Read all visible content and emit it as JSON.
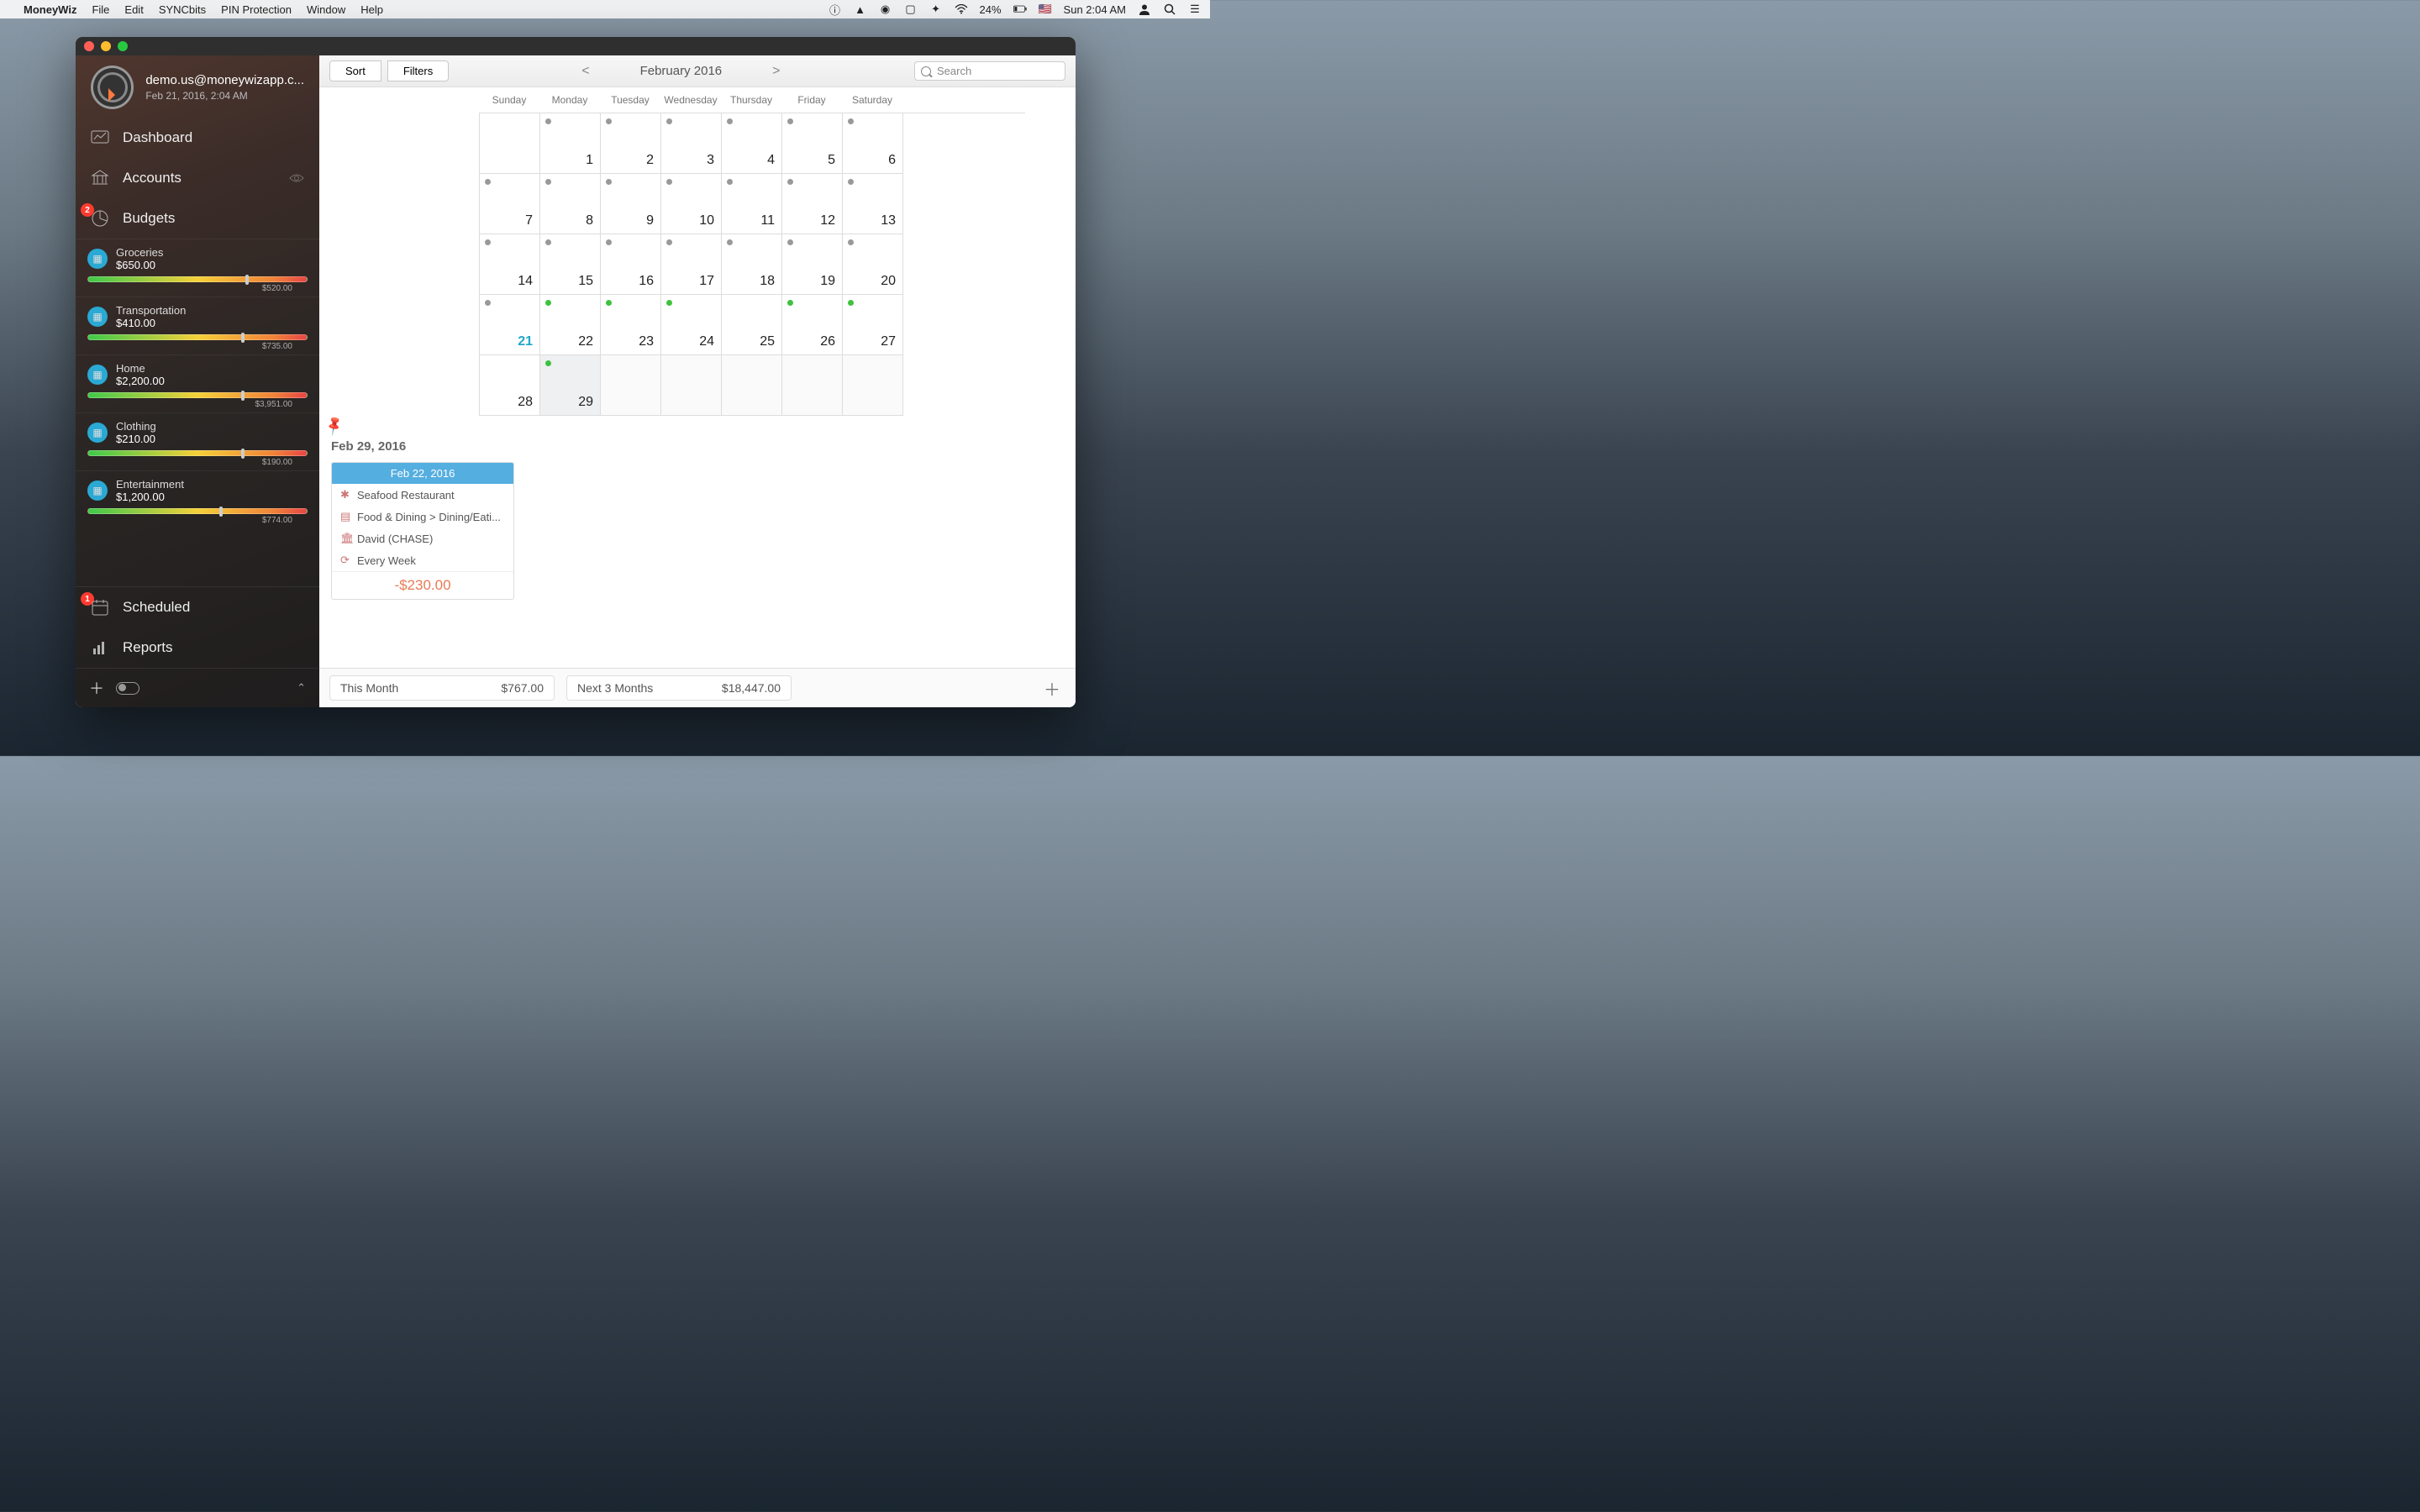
{
  "menubar": {
    "app": "MoneyWiz",
    "items": [
      "File",
      "Edit",
      "SYNCbits",
      "PIN Protection",
      "Window",
      "Help"
    ],
    "battery": "24%",
    "clock": "Sun 2:04 AM"
  },
  "profile": {
    "email": "demo.us@moneywizapp.c...",
    "datetime": "Feb 21, 2016, 2:04 AM"
  },
  "nav": {
    "dashboard": "Dashboard",
    "accounts": "Accounts",
    "budgets": "Budgets",
    "budgets_badge": "2",
    "scheduled": "Scheduled",
    "scheduled_badge": "1",
    "reports": "Reports"
  },
  "budgets": [
    {
      "name": "Groceries",
      "amount": "$650.00",
      "sub": "$520.00",
      "knob": 72
    },
    {
      "name": "Transportation",
      "amount": "$410.00",
      "sub": "$735.00",
      "knob": 70
    },
    {
      "name": "Home",
      "amount": "$2,200.00",
      "sub": "$3,951.00",
      "knob": 70
    },
    {
      "name": "Clothing",
      "amount": "$210.00",
      "sub": "$190.00",
      "knob": 70
    },
    {
      "name": "Entertainment",
      "amount": "$1,200.00",
      "sub": "$774.00",
      "knob": 60
    }
  ],
  "toolbar": {
    "sort": "Sort",
    "filters": "Filters",
    "prev": "<",
    "month": "February 2016",
    "next": ">",
    "search_placeholder": "Search"
  },
  "calendar": {
    "days": [
      "Sunday",
      "Monday",
      "Tuesday",
      "Wednesday",
      "Thursday",
      "Friday",
      "Saturday"
    ],
    "weeks": [
      [
        {
          "n": "",
          "dot": ""
        },
        {
          "n": "1",
          "dot": "g"
        },
        {
          "n": "2",
          "dot": "g"
        },
        {
          "n": "3",
          "dot": "g"
        },
        {
          "n": "4",
          "dot": "g"
        },
        {
          "n": "5",
          "dot": "g"
        },
        {
          "n": "6",
          "dot": "g"
        }
      ],
      [
        {
          "n": "7",
          "dot": "g"
        },
        {
          "n": "8",
          "dot": "g"
        },
        {
          "n": "9",
          "dot": "g"
        },
        {
          "n": "10",
          "dot": "g"
        },
        {
          "n": "11",
          "dot": "g"
        },
        {
          "n": "12",
          "dot": "g"
        },
        {
          "n": "13",
          "dot": "g"
        }
      ],
      [
        {
          "n": "14",
          "dot": "g"
        },
        {
          "n": "15",
          "dot": "g"
        },
        {
          "n": "16",
          "dot": "g"
        },
        {
          "n": "17",
          "dot": "g"
        },
        {
          "n": "18",
          "dot": "g"
        },
        {
          "n": "19",
          "dot": "g"
        },
        {
          "n": "20",
          "dot": "g"
        }
      ],
      [
        {
          "n": "21",
          "dot": "g",
          "today": true
        },
        {
          "n": "22",
          "dot": "gr"
        },
        {
          "n": "23",
          "dot": "gr"
        },
        {
          "n": "24",
          "dot": "gr"
        },
        {
          "n": "25",
          "dot": ""
        },
        {
          "n": "26",
          "dot": "gr"
        },
        {
          "n": "27",
          "dot": "gr"
        }
      ],
      [
        {
          "n": "28",
          "dot": ""
        },
        {
          "n": "29",
          "dot": "gr",
          "sel": true
        },
        {
          "n": "",
          "dot": "",
          "out": true
        },
        {
          "n": "",
          "dot": "",
          "out": true
        },
        {
          "n": "",
          "dot": "",
          "out": true
        },
        {
          "n": "",
          "dot": "",
          "out": true
        },
        {
          "n": "",
          "dot": "",
          "out": true
        }
      ]
    ]
  },
  "detail": {
    "header": "Feb 29, 2016",
    "card_date": "Feb 22, 2016",
    "rows": [
      {
        "icon": "✱",
        "text": "Seafood Restaurant"
      },
      {
        "icon": "▤",
        "text": "Food & Dining > Dining/Eati..."
      },
      {
        "icon": "🏛",
        "text": "David (CHASE)"
      },
      {
        "icon": "⟳",
        "text": "Every Week"
      }
    ],
    "amount": "-$230.00"
  },
  "status": {
    "thisMonthLabel": "This Month",
    "thisMonthVal": "$767.00",
    "next3Label": "Next 3 Months",
    "next3Val": "$18,447.00"
  }
}
